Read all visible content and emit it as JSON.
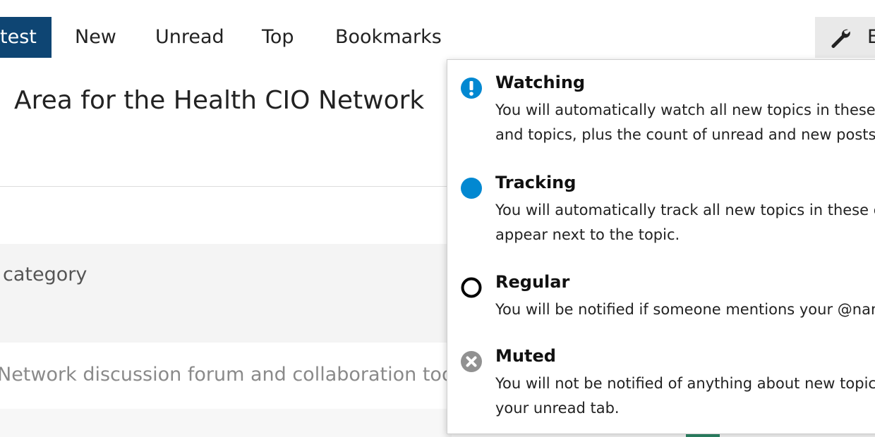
{
  "nav": {
    "tabs": [
      {
        "label": "test",
        "active": true
      },
      {
        "label": "New",
        "active": false
      },
      {
        "label": "Unread",
        "active": false
      },
      {
        "label": "Top",
        "active": false
      },
      {
        "label": "Bookmarks",
        "active": false
      }
    ],
    "edit_label": "E"
  },
  "page": {
    "title": "Area for the Health CIO Network",
    "table_header": "category",
    "category_description": "Network discussion forum and collaboration tools"
  },
  "notification_menu": {
    "options": [
      {
        "icon": "exclamation-circle-icon",
        "title": "Watching",
        "desc_line1": "You will automatically watch all new topics in these categ",
        "desc_line2": "and topics, plus the count of unread and new posts will a"
      },
      {
        "icon": "filled-circle-icon",
        "title": "Tracking",
        "desc_line1": "You will automatically track all new topics in these categ",
        "desc_line2": "appear next to the topic."
      },
      {
        "icon": "empty-circle-icon",
        "title": "Regular",
        "desc_line1": "You will be notified if someone mentions your @name or"
      },
      {
        "icon": "times-circle-icon",
        "title": "Muted",
        "desc_line1": "You will not be notified of anything about new topics in t",
        "desc_line2": "your unread tab."
      }
    ]
  },
  "colors": {
    "nav_active_bg": "#0e4573",
    "watching_icon": "#0288d1",
    "tracking_icon": "#0288d1",
    "muted_icon": "#919191"
  }
}
